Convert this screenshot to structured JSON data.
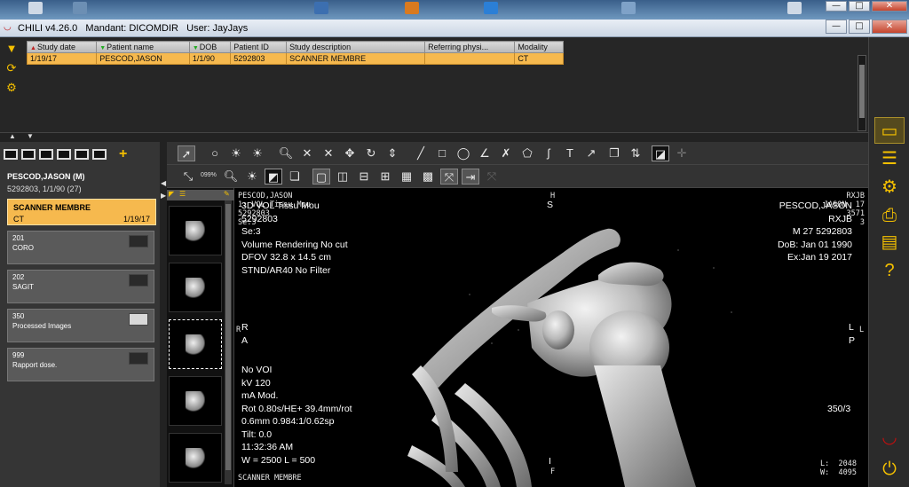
{
  "window": {
    "title": "CHILI v4.26.0   Mandant: DICOMDIR   User: JayJays",
    "min": "—",
    "max": "□",
    "close": "✕"
  },
  "study_table": {
    "columns": [
      "Study date",
      "Patient name",
      "DOB",
      "Patient ID",
      "Study description",
      "Referring physi...",
      "Modality"
    ],
    "rows": [
      [
        "1/19/17",
        "PESCOD,JASON",
        "1/1/90",
        "5292803",
        "SCANNER MEMBRE",
        "",
        "CT"
      ]
    ]
  },
  "patient": {
    "name": "PESCOD,JASON (M)",
    "info": "5292803, 1/1/90 (27)"
  },
  "study_card": {
    "title": "SCANNER MEMBRE",
    "modality": "CT",
    "date": "1/19/17"
  },
  "series": [
    {
      "number": "201",
      "desc": "CORO"
    },
    {
      "number": "202",
      "desc": "SAGIT"
    },
    {
      "number": "350",
      "desc": "Processed Images"
    },
    {
      "number": "999",
      "desc": "Rapport dose."
    }
  ],
  "toolbar2": {
    "zoom_label": "099%"
  },
  "thumbnails": [
    "1",
    "2",
    "3",
    "4",
    "5"
  ],
  "viewer": {
    "top_left_header": "PESCOD,JASON\n1: VOL Tissu Mou\n5292803\nSe:3",
    "top_left_main": "3D VOL Tissu Mou\n5292803\nSe:3\nVolume Rendering No cut\nDFOV 32.8 x 14.5 cm\nSTND/AR40 No Filter",
    "top_right_mono": "RXJB\nJASON  17\n3571\n3",
    "top_right_main": "PESCOD,JASON\nRXJB\nM 27 5292803\nDoB: Jan 01 1990\nEx:Jan 19 2017",
    "orient_top_small": "H",
    "orient_top": "S",
    "orient_left_small": "R",
    "orient_left": "R\nA",
    "orient_right_small": "L",
    "orient_right": "L\nP",
    "orient_bottom_small": "F",
    "orient_bottom": "I",
    "bottom_left_main": "No VOI\nkV 120\nmA Mod.\nRot 0.80s/HE+ 39.4mm/rot\n0.6mm 0.984:1/0.62sp\nTilt: 0.0\n11:32:36 AM\nW = 2500 L = 500",
    "bottom_left_mono": "SCANNER MEMBRE",
    "slice": "350/3",
    "wl": "L:  2048\nW:  4095"
  },
  "colors": {
    "accent": "#f6b94e",
    "icon_yellow": "#f5c000",
    "brand_red": "#c20f0f"
  }
}
